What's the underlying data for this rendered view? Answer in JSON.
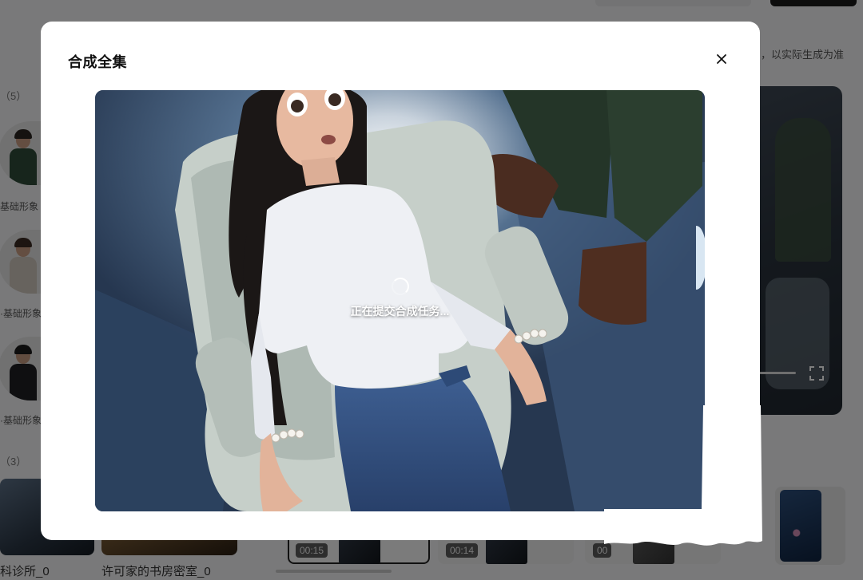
{
  "modal": {
    "title": "合成全集",
    "close_icon": "close-icon",
    "loading_text": "正在提交合成任务..."
  },
  "background": {
    "note_text": "，以实际生成为准",
    "section_characters_count": "（5）",
    "section_scenes_count": "（3）",
    "avatar_labels": [
      "基础形象",
      "·基础形象",
      "·基础形象"
    ],
    "scene_captions": [
      "科诊所_0",
      "许可家的书房密室_0"
    ],
    "clip_durations": [
      "00:15",
      "00:14",
      "00"
    ],
    "fullscreen_icon": "fullscreen-icon"
  },
  "colors": {
    "overlay": "#000000",
    "modal_bg": "#ffffff",
    "title_text": "#111111"
  }
}
